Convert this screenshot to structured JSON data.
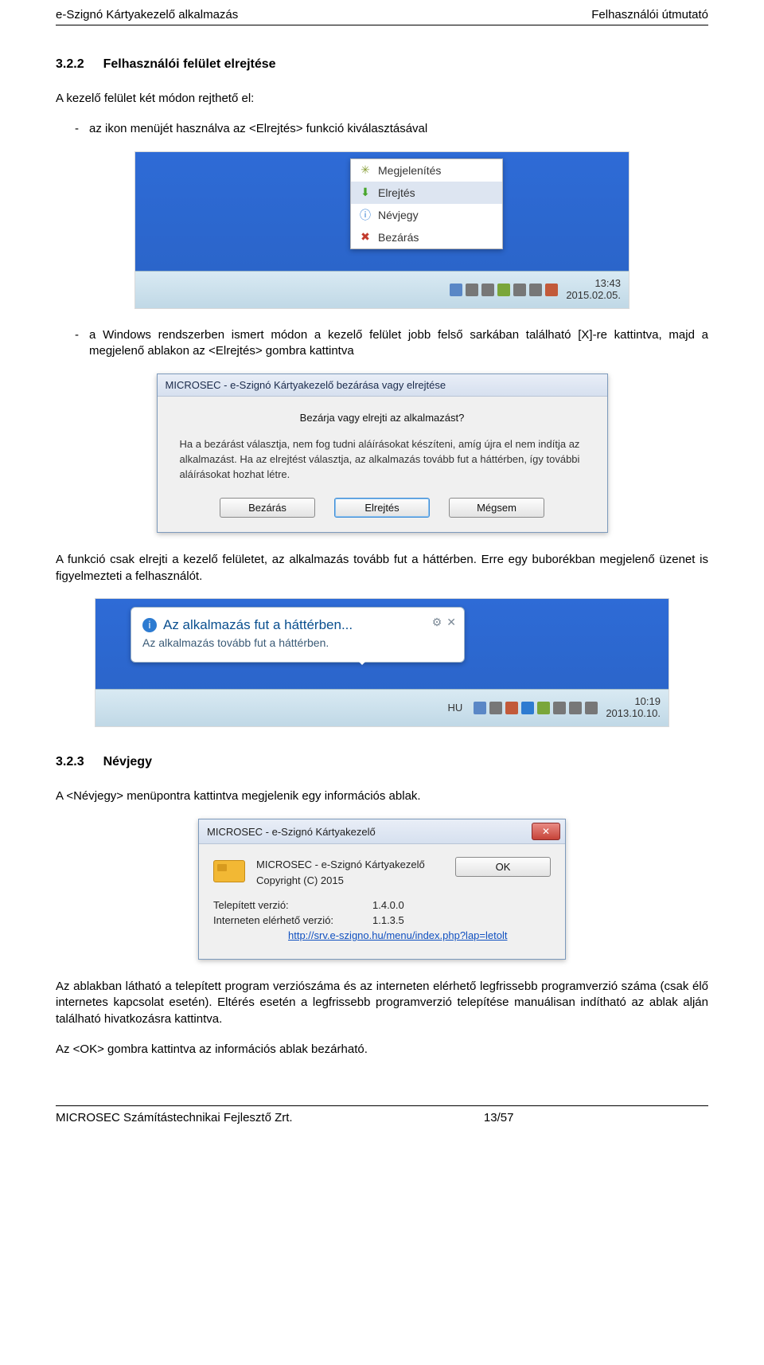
{
  "header": {
    "left": "e-Szignó Kártyakezelő alkalmazás",
    "right": "Felhasználói útmutató"
  },
  "section1": {
    "num": "3.2.2",
    "title": "Felhasználói felület elrejtése",
    "intro": "A kezelő felület két módon rejthető el:",
    "bullet1": "az ikon menüjét használva az <Elrejtés> funkció kiválasztásával",
    "bullet2": "a Windows rendszerben ismert módon a kezelő felület jobb felső sarkában található [X]-re kattintva, majd a megjelenő ablakon az <Elrejtés> gombra kattintva",
    "para_after": "A funkció csak elrejti a kezelő felületet, az alkalmazás tovább fut a háttérben. Erre egy buborékban megjelenő üzenet is figyelmezteti a felhasználót."
  },
  "figure1": {
    "menu_items": [
      "Megjelenítés",
      "Elrejtés",
      "Névjegy",
      "Bezárás"
    ],
    "time": "13:43",
    "date": "2015.02.05."
  },
  "figure2": {
    "title": "MICROSEC - e-Szignó Kártyakezelő bezárása vagy elrejtése",
    "question": "Bezárja vagy elrejti az alkalmazást?",
    "text": "Ha a bezárást választja, nem fog tudni aláírásokat készíteni, amíg újra el nem indítja az alkalmazást. Ha az elrejtést választja, az alkalmazás tovább fut a háttérben, így további aláírásokat hozhat létre.",
    "btn_close": "Bezárás",
    "btn_hide": "Elrejtés",
    "btn_cancel": "Mégsem"
  },
  "figure3": {
    "bubble_title": "Az alkalmazás fut a háttérben...",
    "bubble_sub": "Az alkalmazás tovább fut a háttérben.",
    "lang": "HU",
    "time": "10:19",
    "date": "2013.10.10."
  },
  "section2": {
    "num": "3.2.3",
    "title": "Névjegy",
    "intro": "A <Névjegy> menüpontra kattintva megjelenik egy információs ablak.",
    "para1": "Az ablakban látható a telepített program verziószáma és az interneten elérhető legfrissebb programverzió száma (csak élő internetes kapcsolat esetén). Eltérés esetén a legfrissebb programverzió telepítése manuálisan indítható az ablak alján található hivatkozásra kattintva.",
    "para2": "Az <OK> gombra kattintva az információs ablak bezárható."
  },
  "figure4": {
    "title": "MICROSEC - e-Szignó Kártyakezelő",
    "name": "MICROSEC - e-Szignó Kártyakezelő",
    "copyright": "Copyright (C) 2015",
    "ok": "OK",
    "installed_label": "Telepített verzió:",
    "installed_value": "1.4.0.0",
    "net_label": "Interneten elérhető verzió:",
    "net_value": "1.1.3.5",
    "link": "http://srv.e-szigno.hu/menu/index.php?lap=letolt"
  },
  "footer": {
    "left": "MICROSEC Számítástechnikai Fejlesztő Zrt.",
    "page": "13/57"
  }
}
